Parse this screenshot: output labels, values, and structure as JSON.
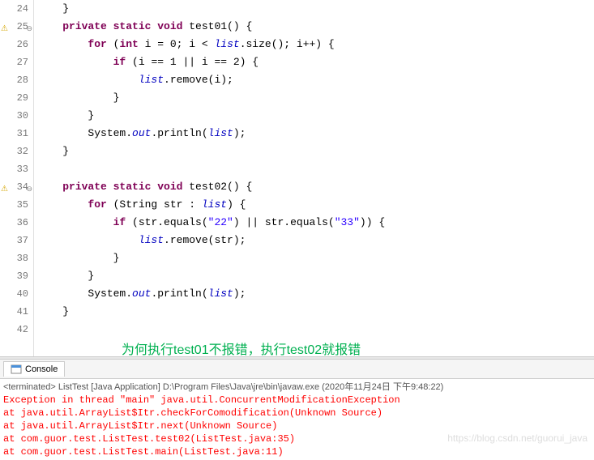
{
  "editor": {
    "lines": [
      {
        "num": 24,
        "marker": "",
        "collapse": "",
        "tokens": [
          {
            "t": "    }",
            "c": ""
          }
        ]
      },
      {
        "num": 25,
        "marker": "warn",
        "collapse": "⊖",
        "tokens": [
          {
            "t": "    ",
            "c": ""
          },
          {
            "t": "private static void",
            "c": "kw"
          },
          {
            "t": " test01() {",
            "c": ""
          }
        ]
      },
      {
        "num": 26,
        "marker": "",
        "collapse": "",
        "tokens": [
          {
            "t": "        ",
            "c": ""
          },
          {
            "t": "for",
            "c": "kw"
          },
          {
            "t": " (",
            "c": ""
          },
          {
            "t": "int",
            "c": "kw"
          },
          {
            "t": " i = 0; i < ",
            "c": ""
          },
          {
            "t": "list",
            "c": "field"
          },
          {
            "t": ".size(); i++) {",
            "c": ""
          }
        ]
      },
      {
        "num": 27,
        "marker": "",
        "collapse": "",
        "tokens": [
          {
            "t": "            ",
            "c": ""
          },
          {
            "t": "if",
            "c": "kw"
          },
          {
            "t": " (i == 1 || i == 2) {",
            "c": ""
          }
        ]
      },
      {
        "num": 28,
        "marker": "",
        "collapse": "",
        "tokens": [
          {
            "t": "                ",
            "c": ""
          },
          {
            "t": "list",
            "c": "field"
          },
          {
            "t": ".remove(i);",
            "c": ""
          }
        ]
      },
      {
        "num": 29,
        "marker": "",
        "collapse": "",
        "tokens": [
          {
            "t": "            }",
            "c": ""
          }
        ]
      },
      {
        "num": 30,
        "marker": "",
        "collapse": "",
        "tokens": [
          {
            "t": "        }",
            "c": ""
          }
        ]
      },
      {
        "num": 31,
        "marker": "",
        "collapse": "",
        "tokens": [
          {
            "t": "        System.",
            "c": ""
          },
          {
            "t": "out",
            "c": "field"
          },
          {
            "t": ".println(",
            "c": ""
          },
          {
            "t": "list",
            "c": "field"
          },
          {
            "t": ");",
            "c": ""
          }
        ]
      },
      {
        "num": 32,
        "marker": "",
        "collapse": "",
        "tokens": [
          {
            "t": "    }",
            "c": ""
          }
        ]
      },
      {
        "num": 33,
        "marker": "",
        "collapse": "",
        "tokens": [
          {
            "t": "",
            "c": ""
          }
        ]
      },
      {
        "num": 34,
        "marker": "warn",
        "collapse": "⊖",
        "tokens": [
          {
            "t": "    ",
            "c": ""
          },
          {
            "t": "private static void",
            "c": "kw"
          },
          {
            "t": " test02() {",
            "c": ""
          }
        ]
      },
      {
        "num": 35,
        "marker": "",
        "collapse": "",
        "tokens": [
          {
            "t": "        ",
            "c": ""
          },
          {
            "t": "for",
            "c": "kw"
          },
          {
            "t": " (String str : ",
            "c": ""
          },
          {
            "t": "list",
            "c": "field"
          },
          {
            "t": ") {",
            "c": ""
          }
        ]
      },
      {
        "num": 36,
        "marker": "",
        "collapse": "",
        "tokens": [
          {
            "t": "            ",
            "c": ""
          },
          {
            "t": "if",
            "c": "kw"
          },
          {
            "t": " (str.equals(",
            "c": ""
          },
          {
            "t": "\"22\"",
            "c": "str"
          },
          {
            "t": ") || str.equals(",
            "c": ""
          },
          {
            "t": "\"33\"",
            "c": "str"
          },
          {
            "t": ")) {",
            "c": ""
          }
        ]
      },
      {
        "num": 37,
        "marker": "",
        "collapse": "",
        "tokens": [
          {
            "t": "                ",
            "c": ""
          },
          {
            "t": "list",
            "c": "field"
          },
          {
            "t": ".remove(str);",
            "c": ""
          }
        ]
      },
      {
        "num": 38,
        "marker": "",
        "collapse": "",
        "tokens": [
          {
            "t": "            }",
            "c": ""
          }
        ]
      },
      {
        "num": 39,
        "marker": "",
        "collapse": "",
        "tokens": [
          {
            "t": "        }",
            "c": ""
          }
        ]
      },
      {
        "num": 40,
        "marker": "",
        "collapse": "",
        "tokens": [
          {
            "t": "        System.",
            "c": ""
          },
          {
            "t": "out",
            "c": "field"
          },
          {
            "t": ".println(",
            "c": ""
          },
          {
            "t": "list",
            "c": "field"
          },
          {
            "t": ");",
            "c": ""
          }
        ]
      },
      {
        "num": 41,
        "marker": "",
        "collapse": "",
        "tokens": [
          {
            "t": "    }",
            "c": ""
          }
        ]
      },
      {
        "num": 42,
        "marker": "",
        "collapse": "",
        "tokens": [
          {
            "t": "",
            "c": ""
          }
        ]
      }
    ],
    "annotation": "为何执行test01不报错，执行test02就报错"
  },
  "console": {
    "tab_label": "Console",
    "terminated": "<terminated> ListTest [Java Application] D:\\Program Files\\Java\\jre\\bin\\javaw.exe (2020年11月24日 下午9:48:22)",
    "errors": [
      "Exception in thread \"main\" java.util.ConcurrentModificationException",
      "        at java.util.ArrayList$Itr.checkForComodification(Unknown Source)",
      "        at java.util.ArrayList$Itr.next(Unknown Source)",
      "        at com.guor.test.ListTest.test02(ListTest.java:35)",
      "        at com.guor.test.ListTest.main(ListTest.java:11)"
    ]
  },
  "watermark": "https://blog.csdn.net/guorui_java"
}
